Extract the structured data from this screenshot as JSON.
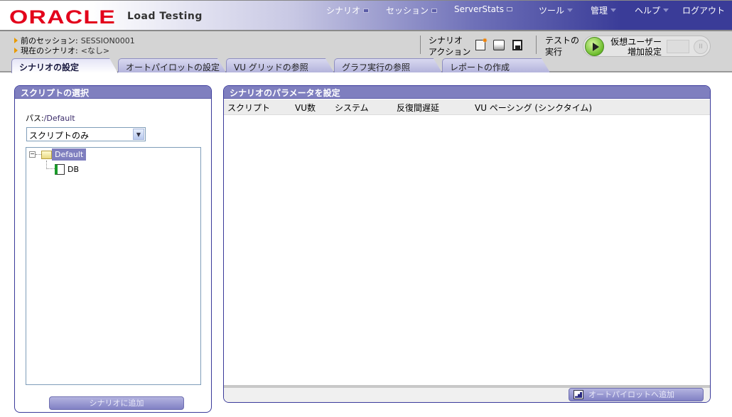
{
  "header": {
    "logo": "ORACLE",
    "product": "Load Testing",
    "menu": [
      {
        "label": "シナリオ"
      },
      {
        "label": "セッション"
      },
      {
        "label": "ServerStats"
      },
      {
        "label": "ツール"
      },
      {
        "label": "管理"
      },
      {
        "label": "ヘルプ"
      },
      {
        "label": "ログアウト"
      }
    ]
  },
  "info": {
    "prev_session_label": "前のセッション:",
    "prev_session_value": "SESSION0001",
    "current_scenario_label": "現在のシナリオ:",
    "current_scenario_value": "<なし>"
  },
  "toolbar": {
    "scenario_action_1": "シナリオ",
    "scenario_action_2": "アクション",
    "run_test_1": "テストの",
    "run_test_2": "実行",
    "vu_ramp_1": "仮想ユーザー",
    "vu_ramp_2": "増加設定"
  },
  "tabs": [
    {
      "label": "シナリオの設定",
      "active": true
    },
    {
      "label": "オートパイロットの設定"
    },
    {
      "label": "VU グリッドの参照"
    },
    {
      "label": "グラフ実行の参照"
    },
    {
      "label": "レポートの作成"
    }
  ],
  "left_panel": {
    "title": "スクリプトの選択",
    "path_label": "パス:",
    "path_value": "/Default",
    "filter_selected": "スクリプトのみ",
    "tree": {
      "folder": "Default",
      "children": [
        "DB"
      ]
    },
    "add_button": "シナリオに追加"
  },
  "right_panel": {
    "title": "シナリオのパラメータを設定",
    "columns": [
      "スクリプト",
      "VU数",
      "システム",
      "反復間遅延",
      "VU ペーシング (シンクタイム)"
    ],
    "rows": [],
    "add_button": "オートパイロットへ追加"
  }
}
